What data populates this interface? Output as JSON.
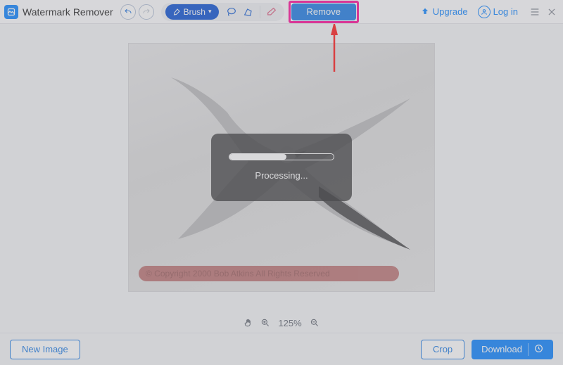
{
  "app": {
    "title": "Watermark Remover"
  },
  "toolbar": {
    "brush_label": "Brush",
    "remove_label": "Remove"
  },
  "header": {
    "upgrade_label": "Upgrade",
    "login_label": "Log in"
  },
  "canvas": {
    "watermark_text": "© Copyright  2000   Bob Atkins   All Rights Reserved"
  },
  "processing": {
    "label": "Processing...",
    "progress_percent": 55
  },
  "zoom": {
    "label": "125%"
  },
  "footer": {
    "new_image_label": "New Image",
    "crop_label": "Crop",
    "download_label": "Download"
  },
  "colors": {
    "accent": "#1f8cff",
    "highlight": "#ff1fa0",
    "annotation": "#ff2b2b"
  }
}
